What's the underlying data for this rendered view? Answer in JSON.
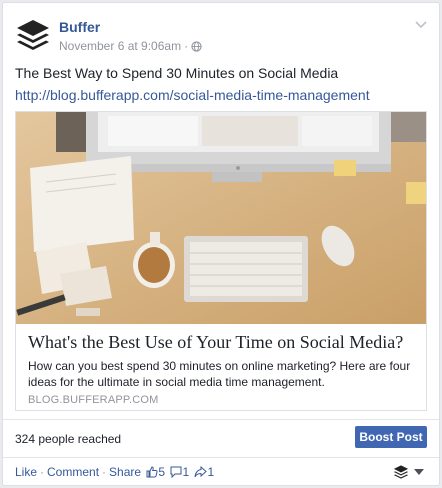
{
  "post": {
    "author": "Buffer",
    "timestamp": "November 6 at 9:06am",
    "privacy_icon": "globe-icon",
    "text": "The Best Way to Spend 30 Minutes on Social Media",
    "link": "http://blog.bufferapp.com/social-media-time-management"
  },
  "preview": {
    "image": "desk-with-imac-keyboard-coffee-photo",
    "title": "What's the Best Use of Your Time on Social Media?",
    "description": "How can you best spend 30 minutes on online marketing? Here are four ideas for the ultimate in social media time management.",
    "domain": "BLOG.BUFFERAPP.COM"
  },
  "reach": {
    "text": "324 people reached",
    "boost_label": "Boost Post"
  },
  "actions": {
    "like": "Like",
    "comment": "Comment",
    "share": "Share",
    "likes_count": "5",
    "comments_count": "1",
    "shares_count": "1"
  },
  "colors": {
    "link": "#365899",
    "boost": "#4267b2",
    "meta": "#90949c"
  }
}
